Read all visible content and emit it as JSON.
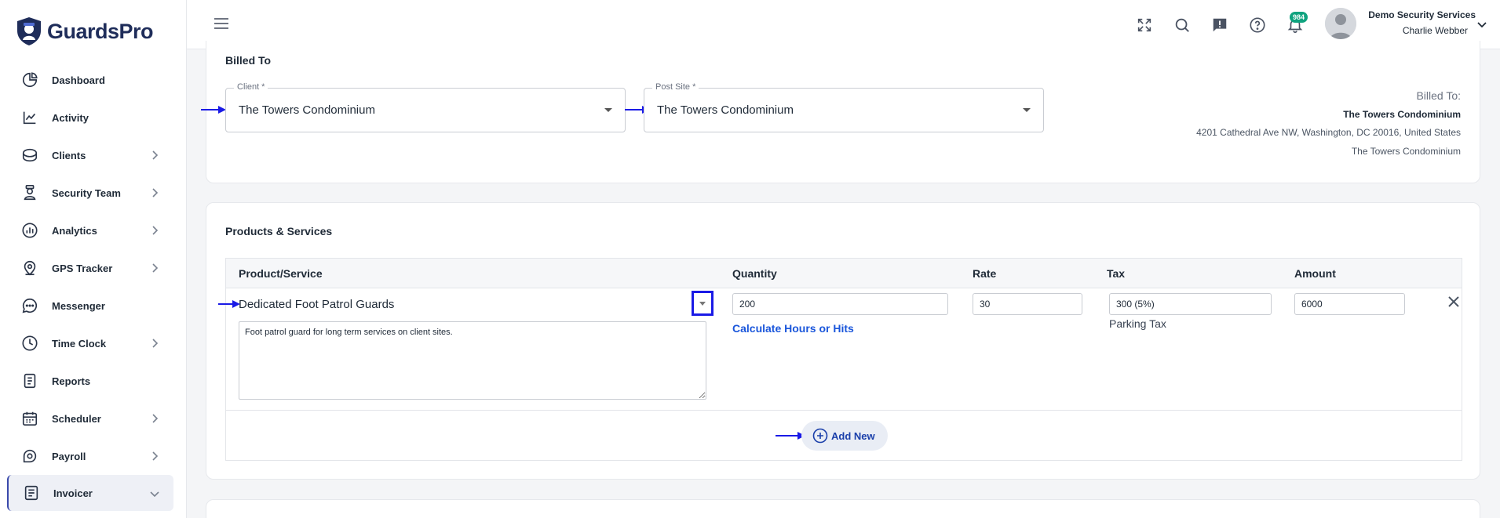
{
  "app": {
    "brand": "GuardsPro"
  },
  "sidebar": {
    "items": [
      {
        "label": "Dashboard",
        "icon": "dashboard-icon",
        "has_chevron": false
      },
      {
        "label": "Activity",
        "icon": "activity-icon",
        "has_chevron": false
      },
      {
        "label": "Clients",
        "icon": "clients-icon",
        "has_chevron": true
      },
      {
        "label": "Security Team",
        "icon": "security-team-icon",
        "has_chevron": true
      },
      {
        "label": "Analytics",
        "icon": "analytics-icon",
        "has_chevron": true
      },
      {
        "label": "GPS Tracker",
        "icon": "location-pin-icon",
        "has_chevron": true
      },
      {
        "label": "Messenger",
        "icon": "chat-bubble-icon",
        "has_chevron": false
      },
      {
        "label": "Time Clock",
        "icon": "clock-icon",
        "has_chevron": true
      },
      {
        "label": "Reports",
        "icon": "report-icon",
        "has_chevron": false
      },
      {
        "label": "Scheduler",
        "icon": "calendar-icon",
        "has_chevron": true
      },
      {
        "label": "Payroll",
        "icon": "payroll-icon",
        "has_chevron": true
      },
      {
        "label": "Invoicer",
        "icon": "invoice-icon",
        "has_chevron": true,
        "active": true
      }
    ]
  },
  "topbar": {
    "notification_count": "984",
    "user_company": "Demo Security Services",
    "user_name": "Charlie Webber"
  },
  "billed_to": {
    "section_title": "Billed To",
    "client_label": "Client *",
    "client_value": "The Towers Condominium",
    "post_site_label": "Post Site *",
    "post_site_value": "The Towers Condominium",
    "summary_heading": "Billed To:",
    "summary_name": "The Towers Condominium",
    "summary_address": "4201 Cathedral Ave NW, Washington, DC 20016, United States",
    "summary_site": "The Towers Condominium"
  },
  "products": {
    "section_title": "Products & Services",
    "columns": [
      "Product/Service",
      "Quantity",
      "Rate",
      "Tax",
      "Amount"
    ],
    "row": {
      "product": "Dedicated Foot Patrol Guards",
      "description": "Foot patrol guard for long term services on client sites.",
      "quantity": "200",
      "rate": "30",
      "tax": "300 (5%)",
      "tax_name": "Parking Tax",
      "amount": "6000",
      "calc_link": "Calculate Hours or Hits"
    },
    "add_new_label": "Add New"
  },
  "colors": {
    "accent": "#1a1ae6",
    "brand": "#1f2d5a",
    "badge": "#10a37f"
  }
}
